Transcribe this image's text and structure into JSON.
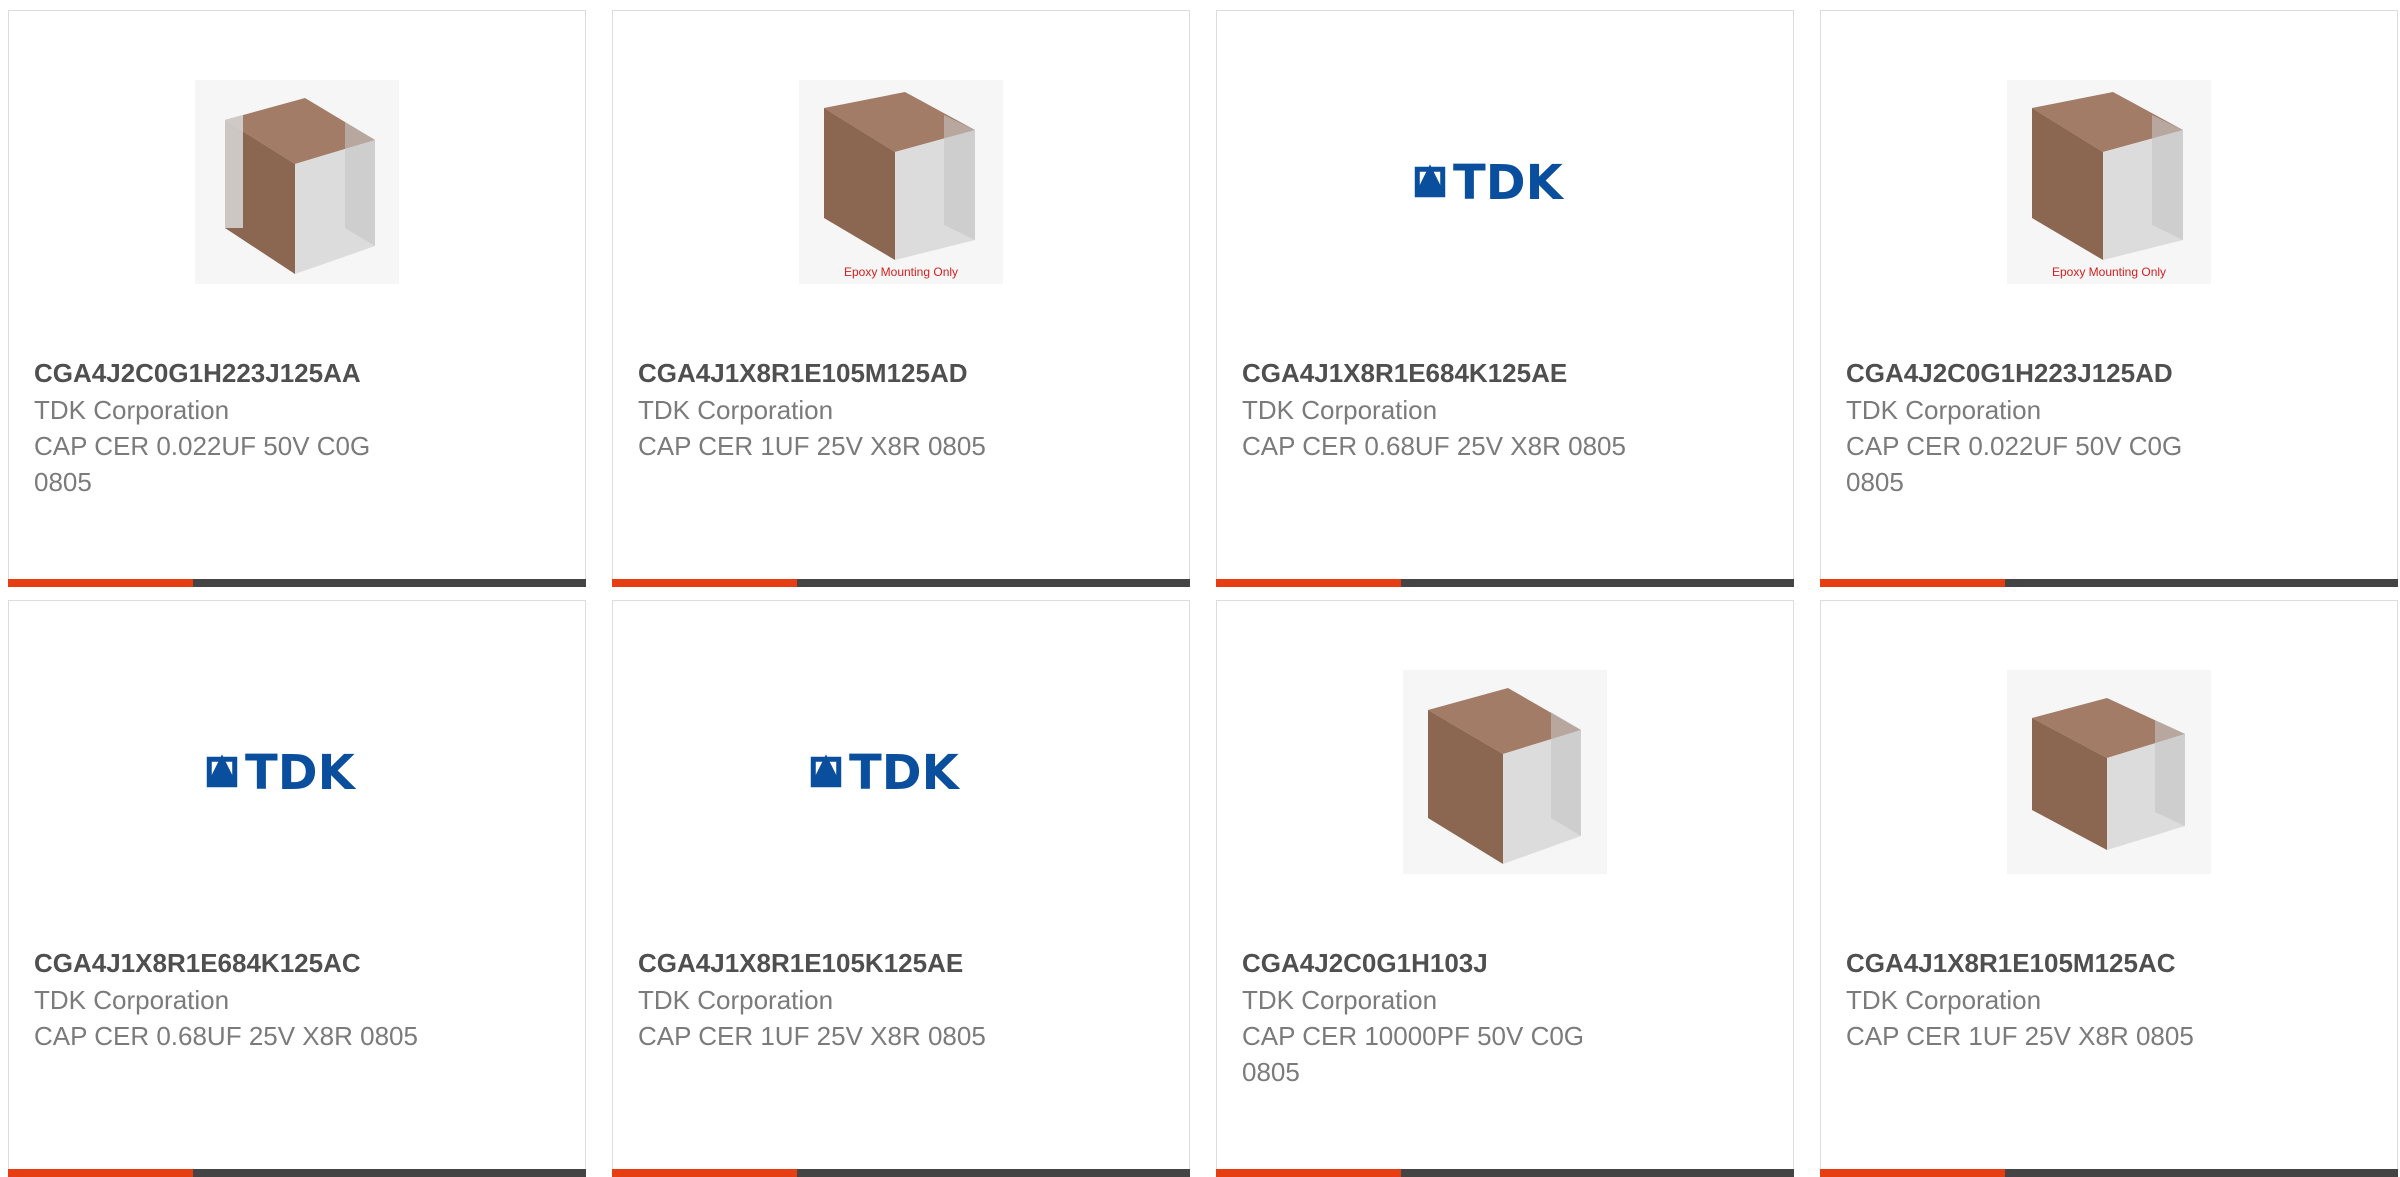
{
  "products": [
    {
      "part_number": "CGA4J2C0G1H223J125AA",
      "manufacturer": "TDK Corporation",
      "description": "CAP CER 0.022UF 50V C0G 0805",
      "image": "capacitor-chip",
      "image_caption": ""
    },
    {
      "part_number": "CGA4J1X8R1E105M125AD",
      "manufacturer": "TDK Corporation",
      "description": "CAP CER 1UF 25V X8R 0805",
      "image": "capacitor-chip",
      "image_caption": "Epoxy Mounting Only"
    },
    {
      "part_number": "CGA4J1X8R1E684K125AE",
      "manufacturer": "TDK Corporation",
      "description": "CAP CER 0.68UF 25V X8R 0805",
      "image": "tdk-logo",
      "image_caption": "",
      "logo_text": "TDK"
    },
    {
      "part_number": "CGA4J2C0G1H223J125AD",
      "manufacturer": "TDK Corporation",
      "description": "CAP CER 0.022UF 50V C0G 0805",
      "image": "capacitor-chip",
      "image_caption": "Epoxy Mounting Only"
    },
    {
      "part_number": "CGA4J1X8R1E684K125AC",
      "manufacturer": "TDK Corporation",
      "description": "CAP CER 0.68UF 25V X8R 0805",
      "image": "tdk-logo",
      "image_caption": "",
      "logo_text": "TDK"
    },
    {
      "part_number": "CGA4J1X8R1E105K125AE",
      "manufacturer": "TDK Corporation",
      "description": "CAP CER 1UF 25V X8R 0805",
      "image": "tdk-logo",
      "image_caption": "",
      "logo_text": "TDK"
    },
    {
      "part_number": "CGA4J2C0G1H103J",
      "manufacturer": "TDK Corporation",
      "description": "CAP CER 10000PF 50V C0G 0805",
      "image": "capacitor-chip",
      "image_caption": ""
    },
    {
      "part_number": "CGA4J1X8R1E105M125AC",
      "manufacturer": "TDK Corporation",
      "description": "CAP CER 1UF 25V X8R 0805",
      "image": "capacitor-chip",
      "image_caption": ""
    }
  ],
  "colors": {
    "accent": "#e63e12",
    "bar": "#444444",
    "tdk_blue": "#0a4f9e",
    "caption_red": "#d42020"
  }
}
